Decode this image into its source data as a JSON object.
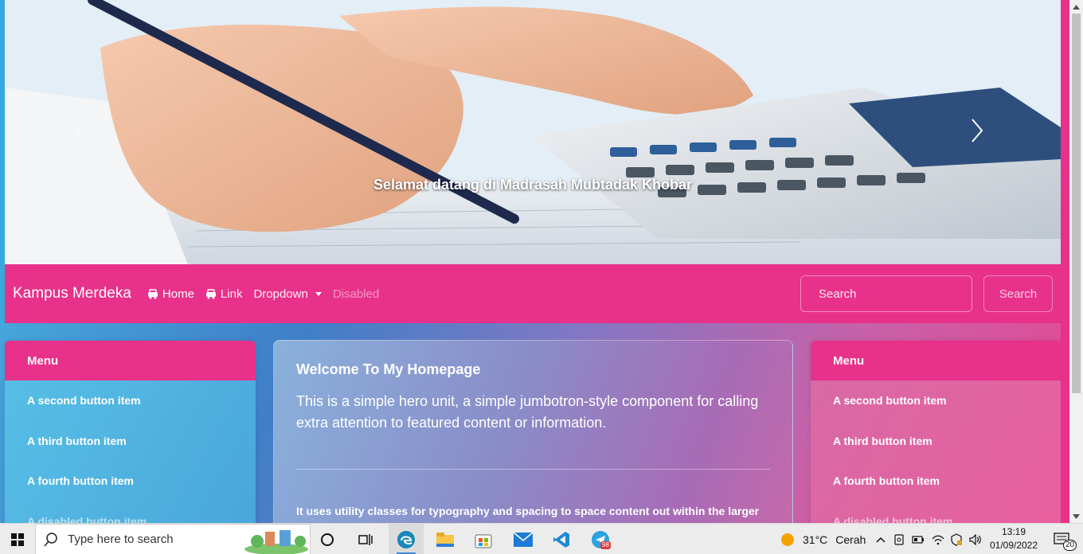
{
  "carousel": {
    "caption": "Selamat datang di Madrasah Mubtadak Khobar",
    "prev_icon": "chevron-left-icon",
    "next_icon": "chevron-right-icon"
  },
  "navbar": {
    "brand": "Kampus Merdeka",
    "links": [
      {
        "label": "Home",
        "icon": "car-icon",
        "state": "active"
      },
      {
        "label": "Link",
        "icon": "car-icon",
        "state": "normal"
      },
      {
        "label": "Dropdown",
        "icon": "caret-down-icon",
        "state": "normal"
      },
      {
        "label": "Disabled",
        "state": "disabled"
      }
    ],
    "search_placeholder": "Search",
    "search_button": "Search"
  },
  "menu_left": {
    "header": "Menu",
    "items": [
      "A second button item",
      "A third button item",
      "A fourth button item",
      "A disabled button item"
    ]
  },
  "menu_right": {
    "header": "Menu",
    "items": [
      "A second button item",
      "A third button item",
      "A fourth button item",
      "A disabled button item"
    ]
  },
  "jumbotron": {
    "title": "Welcome To My Homepage",
    "lead": "This is a simple hero unit, a simple jumbotron-style component for calling extra attention to featured content or information.",
    "body": "It uses utility classes for typography and spacing to space content out within the larger"
  },
  "taskbar": {
    "search_placeholder": "Type here to search",
    "weather_temp": "31°C",
    "weather_desc": "Cerah",
    "time": "13:19",
    "date": "01/09/2022",
    "notification_count": "20",
    "telegram_badge": "98"
  },
  "colors": {
    "accent_pink": "#e8318a",
    "gradient_blue": "#4ab8e6",
    "gradient_pink": "#e84591"
  }
}
